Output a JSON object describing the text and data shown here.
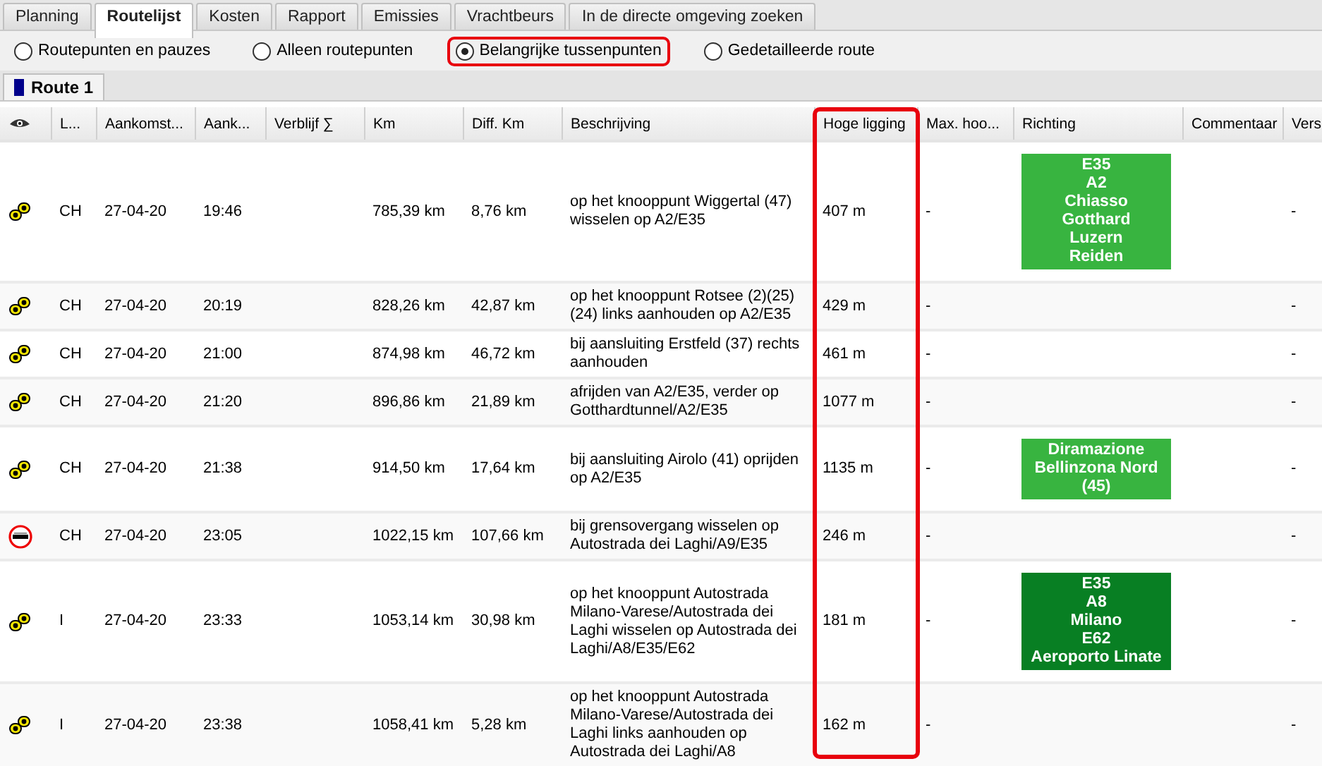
{
  "tabs": [
    {
      "label": "Planning",
      "selected": false
    },
    {
      "label": "Routelijst",
      "selected": true
    },
    {
      "label": "Kosten",
      "selected": false
    },
    {
      "label": "Rapport",
      "selected": false
    },
    {
      "label": "Emissies",
      "selected": false
    },
    {
      "label": "Vrachtbeurs",
      "selected": false
    },
    {
      "label": "In de directe omgeving zoeken",
      "selected": false
    }
  ],
  "view_options": [
    {
      "label": "Routepunten en pauzes",
      "selected": false,
      "highlighted": false
    },
    {
      "label": "Alleen routepunten",
      "selected": false,
      "highlighted": false
    },
    {
      "label": "Belangrijke tussenpunten",
      "selected": true,
      "highlighted": true
    },
    {
      "label": "Gedetailleerde route",
      "selected": false,
      "highlighted": false
    }
  ],
  "route_tab": {
    "label": "Route 1",
    "color": "#00008b"
  },
  "table": {
    "columns": [
      {
        "kind": "eye",
        "highlighted": false
      },
      {
        "label": "L...",
        "highlighted": false
      },
      {
        "label": "Aankomst...",
        "highlighted": false
      },
      {
        "label": "Aank...",
        "highlighted": false
      },
      {
        "label": "Verblijf ∑",
        "highlighted": false
      },
      {
        "label": "Km",
        "highlighted": false
      },
      {
        "label": "Diff. Km",
        "highlighted": false
      },
      {
        "label": "Beschrijving",
        "highlighted": false
      },
      {
        "label": "Hoge ligging",
        "highlighted": true
      },
      {
        "label": "Max. hoo...",
        "highlighted": false
      },
      {
        "label": "Richting",
        "highlighted": false
      },
      {
        "label": "Commentaar",
        "highlighted": false
      },
      {
        "label": "Vers",
        "highlighted": false
      }
    ],
    "rows": [
      {
        "kind": "junction",
        "country": "CH",
        "date": "27-04-20",
        "time": "19:46",
        "km": "785,39 km",
        "diff_km": "8,76 km",
        "description": "op het knooppunt Wiggertal (47) wisselen op A2/E35",
        "elevation": "407 m",
        "max_height": "-",
        "direction": {
          "color": "#38b440",
          "lines": [
            "E35",
            "A2",
            "Chiasso",
            "Gotthard",
            "Luzern",
            "Reiden"
          ]
        },
        "column_13": "-"
      },
      {
        "kind": "junction",
        "country": "CH",
        "date": "27-04-20",
        "time": "20:19",
        "km": "828,26 km",
        "diff_km": "42,87 km",
        "description": "op het knooppunt Rotsee (2)(25)(24) links aanhouden op A2/E35",
        "elevation": "429 m",
        "max_height": "-",
        "column_13": "-"
      },
      {
        "kind": "junction",
        "country": "CH",
        "date": "27-04-20",
        "time": "21:00",
        "km": "874,98 km",
        "diff_km": "46,72 km",
        "description": "bij aansluiting Erstfeld (37) rechts aanhouden",
        "elevation": "461 m",
        "max_height": "-",
        "column_13": "-"
      },
      {
        "kind": "junction",
        "country": "CH",
        "date": "27-04-20",
        "time": "21:20",
        "km": "896,86 km",
        "diff_km": "21,89 km",
        "description": "afrijden van A2/E35, verder op Gotthardtunnel/A2/E35",
        "elevation": "1077 m",
        "max_height": "-",
        "column_13": "-"
      },
      {
        "kind": "junction",
        "country": "CH",
        "date": "27-04-20",
        "time": "21:38",
        "km": "914,50 km",
        "diff_km": "17,64 km",
        "description": "bij aansluiting Airolo (41) oprijden op A2/E35",
        "elevation": "1135 m",
        "max_height": "-",
        "direction": {
          "color": "#38b440",
          "lines": [
            "Diramazione",
            "Bellinzona Nord",
            "(45)"
          ]
        },
        "column_13": "-"
      },
      {
        "kind": "border",
        "country": "CH",
        "date": "27-04-20",
        "time": "23:05",
        "km": "1022,15 km",
        "diff_km": "107,66 km",
        "description": "bij grensovergang wisselen op Autostrada dei Laghi/A9/E35",
        "elevation": "246 m",
        "max_height": "-",
        "column_13": "-"
      },
      {
        "kind": "junction",
        "country": "I",
        "date": "27-04-20",
        "time": "23:33",
        "km": "1053,14 km",
        "diff_km": "30,98 km",
        "description": "op het knooppunt Autostrada Milano-Varese/Autostrada dei Laghi wisselen op Autostrada dei Laghi/A8/E35/E62",
        "elevation": "181 m",
        "max_height": "-",
        "direction": {
          "color": "#087f23",
          "lines": [
            "E35",
            "A8",
            "Milano",
            "E62",
            "Aeroporto Linate"
          ]
        },
        "column_13": "-"
      },
      {
        "kind": "junction",
        "country": "I",
        "date": "27-04-20",
        "time": "23:38",
        "km": "1058,41 km",
        "diff_km": "5,28 km",
        "description": "op het knooppunt Autostrada Milano-Varese/Autostrada dei Laghi links aanhouden op Autostrada dei Laghi/A8",
        "elevation": "162 m",
        "max_height": "-",
        "column_13": "-"
      }
    ]
  }
}
